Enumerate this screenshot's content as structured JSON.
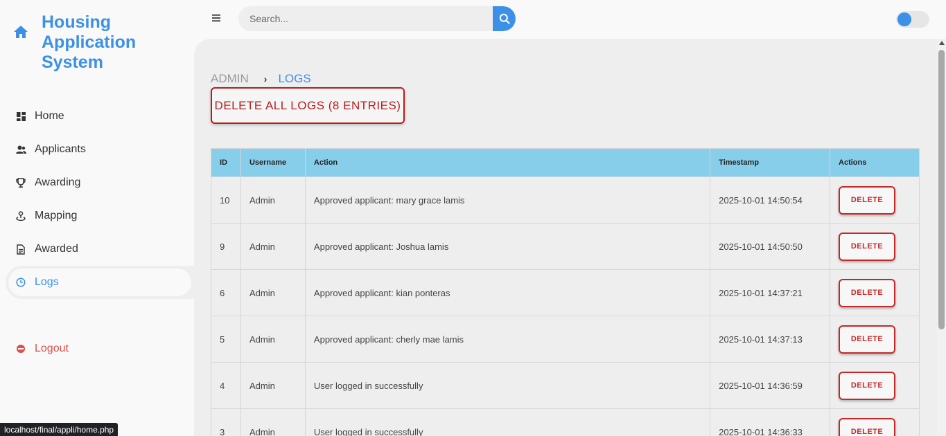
{
  "brand": {
    "title": "Housing Application System",
    "icon": "home-icon"
  },
  "sidebar": {
    "items": [
      {
        "label": "Home",
        "icon": "dashboard-icon"
      },
      {
        "label": "Applicants",
        "icon": "people-icon"
      },
      {
        "label": "Awarding",
        "icon": "trophy-icon"
      },
      {
        "label": "Mapping",
        "icon": "map-pin-icon"
      },
      {
        "label": "Awarded",
        "icon": "document-icon"
      },
      {
        "label": "Logs",
        "icon": "clock-icon",
        "active": true
      }
    ],
    "logout": "Logout"
  },
  "topbar": {
    "search_placeholder": "Search...",
    "toggle_on": false
  },
  "breadcrumb": {
    "parent": "ADMIN",
    "current": "LOGS"
  },
  "delete_all_label": "DELETE ALL LOGS (8 ENTRIES)",
  "table": {
    "headers": [
      "ID",
      "Username",
      "Action",
      "Timestamp",
      "Actions"
    ],
    "rows": [
      {
        "id": "10",
        "username": "Admin",
        "action": "Approved applicant: mary grace lamis",
        "timestamp": "2025-10-01 14:50:54",
        "button": "DELETE"
      },
      {
        "id": "9",
        "username": "Admin",
        "action": "Approved applicant: Joshua lamis",
        "timestamp": "2025-10-01 14:50:50",
        "button": "DELETE"
      },
      {
        "id": "6",
        "username": "Admin",
        "action": "Approved applicant: kian ponteras",
        "timestamp": "2025-10-01 14:37:21",
        "button": "DELETE"
      },
      {
        "id": "5",
        "username": "Admin",
        "action": "Approved applicant: cherly mae lamis",
        "timestamp": "2025-10-01 14:37:13",
        "button": "DELETE"
      },
      {
        "id": "4",
        "username": "Admin",
        "action": "User logged in successfully",
        "timestamp": "2025-10-01 14:36:59",
        "button": "DELETE"
      },
      {
        "id": "3",
        "username": "Admin",
        "action": "User logged in successfully",
        "timestamp": "2025-10-01 14:36:33",
        "button": "DELETE"
      }
    ]
  },
  "status_bar": "localhost/final/appli/home.php",
  "colors": {
    "accent": "#3c91e6",
    "danger": "#b71c1c",
    "header_bg": "#87ceeb",
    "logout": "#db504a"
  }
}
